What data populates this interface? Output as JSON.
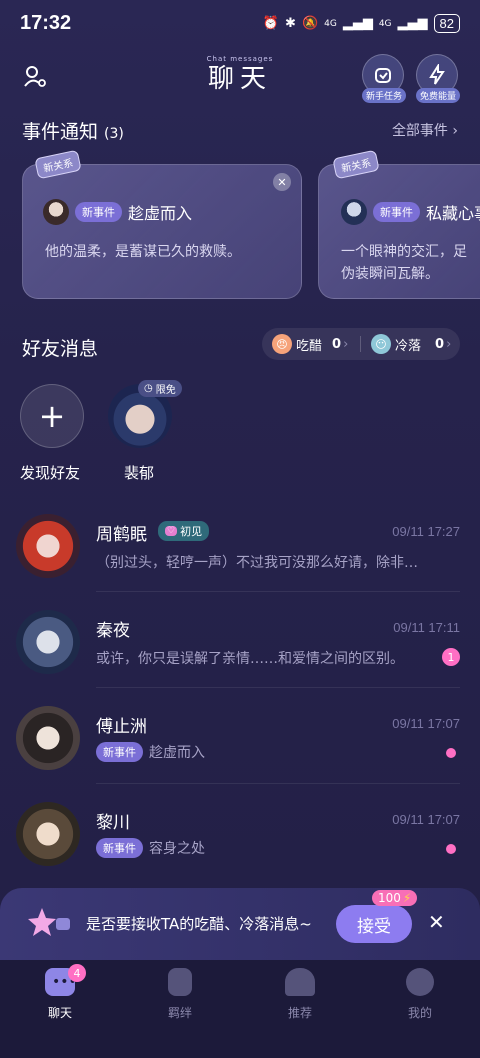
{
  "status": {
    "time": "17:32",
    "battery": "82",
    "net1": "4G",
    "net2": "4G"
  },
  "header": {
    "title": "聊天",
    "subtitle": "Chat messages",
    "btn_task": "新手任务",
    "btn_energy": "免费能量"
  },
  "events": {
    "title": "事件通知",
    "count": "(3)",
    "all_link": "全部事件",
    "cards": [
      {
        "tag": "新关系",
        "pill": "新事件",
        "title": "趁虚而入",
        "desc": "他的温柔，是蓄谋已久的救赎。"
      },
      {
        "tag": "新关系",
        "pill": "新事件",
        "title": "私藏心事",
        "desc1": "一个眼神的交汇，足",
        "desc2": "伪装瞬间瓦解。"
      }
    ]
  },
  "friends": {
    "title": "好友消息",
    "jealous_label": "吃醋",
    "jealous_count": "0",
    "cold_label": "冷落",
    "cold_count": "0",
    "discover_label": "发现好友",
    "featured_name": "裴郁",
    "featured_badge": "限免"
  },
  "chats": [
    {
      "name": "周鹤眠",
      "badge": "初见",
      "time": "09/11 17:27",
      "msg": "（别过头，轻哼一声）不过我可没那么好请，除非…"
    },
    {
      "name": "秦夜",
      "time": "09/11 17:11",
      "msg": "或许，你只是误解了亲情……和爱情之间的区别。",
      "unread": "1"
    },
    {
      "name": "傅止洲",
      "time": "09/11 17:07",
      "pill": "新事件",
      "msg": "趁虚而入"
    },
    {
      "name": "黎川",
      "time": "09/11 17:07",
      "pill": "新事件",
      "msg": "容身之处"
    }
  ],
  "banner": {
    "text": "是否要接收TA的吃醋、冷落消息~",
    "accept": "接受",
    "reward": "100"
  },
  "nav": [
    {
      "label": "聊天",
      "badge": "4"
    },
    {
      "label": "羁绊"
    },
    {
      "label": "推荐"
    },
    {
      "label": "我的"
    }
  ],
  "colors": {
    "accent": "#8d7cf0",
    "pink": "#ff6fc4",
    "bg": "#26234c"
  }
}
